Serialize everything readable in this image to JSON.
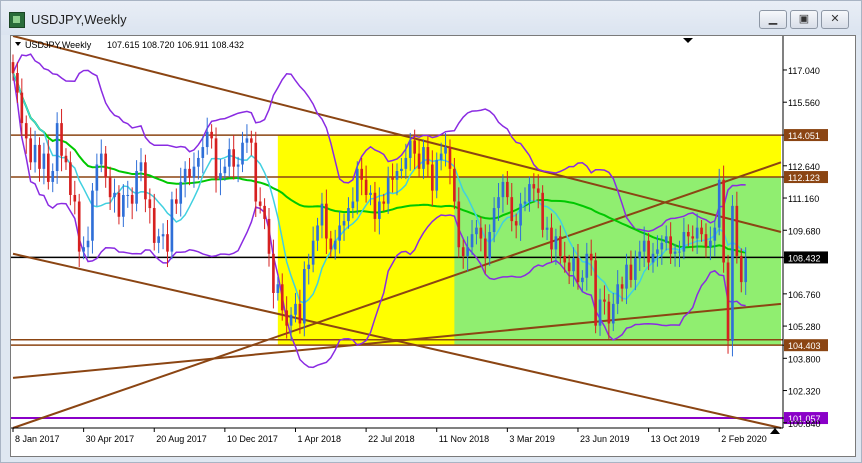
{
  "window": {
    "title": "USDJPY,Weekly",
    "minimize_label": "▁",
    "maximize_label": "▣",
    "close_label": "✕"
  },
  "chart_data": {
    "type": "candlestick",
    "symbol_label": "USDJPY,Weekly",
    "ohlc_readout": "107.615 108.720 106.911 108.432",
    "ylim": [
      100.6,
      118.6
    ],
    "y_ticks": [
      117.04,
      115.56,
      114.051,
      112.64,
      112.123,
      111.16,
      109.68,
      108.432,
      106.76,
      105.28,
      104.403,
      103.8,
      102.32,
      101.057,
      100.84
    ],
    "y_tick_labels": [
      "117.040",
      "115.560",
      "114.051",
      "112.640",
      "112.123",
      "111.160",
      "109.680",
      "108.432",
      "106.760",
      "105.280",
      "104.403",
      "103.800",
      "102.320",
      "101.057",
      "100.840"
    ],
    "x_tick_labels": [
      "8 Jan 2017",
      "30 Apr 2017",
      "20 Aug 2017",
      "10 Dec 2017",
      "1 Apr 2018",
      "22 Jul 2018",
      "11 Nov 2018",
      "3 Mar 2019",
      "23 Jun 2019",
      "13 Oct 2019",
      "2 Feb 2020"
    ],
    "x_dates_week_index": [
      0,
      16,
      32,
      48,
      64,
      80,
      96,
      112,
      128,
      144,
      160
    ],
    "highlight_labels": [
      "114.051",
      "112.123",
      "108.432",
      "104.403",
      "101.057"
    ],
    "highlight_colors": {
      "brown": "#8b4513",
      "black": "#000000",
      "purple": "#8a00c8"
    },
    "candles_close": [
      116.9,
      116.0,
      114.6,
      113.9,
      112.8,
      113.6,
      112.5,
      113.2,
      111.9,
      112.4,
      114.6,
      113.1,
      112.8,
      111.3,
      111.0,
      108.7,
      108.9,
      109.2,
      111.5,
      112.7,
      113.2,
      112.1,
      111.2,
      111.4,
      110.3,
      111.3,
      111.3,
      110.9,
      112.4,
      112.8,
      111.1,
      110.7,
      109.1,
      109.4,
      109.5,
      108.7,
      111.1,
      110.9,
      111.9,
      112.5,
      112.1,
      112.6,
      113.0,
      113.5,
      114.2,
      113.9,
      112.0,
      112.3,
      112.6,
      113.4,
      112.6,
      112.7,
      113.7,
      113.9,
      113.7,
      111.0,
      110.8,
      110.2,
      108.6,
      106.8,
      107.2,
      106.0,
      105.3,
      105.8,
      106.3,
      105.4,
      107.9,
      108.1,
      109.2,
      109.9,
      110.9,
      109.3,
      108.8,
      109.2,
      109.9,
      110.1,
      110.7,
      111.0,
      112.5,
      112.0,
      111.3,
      111.4,
      110.2,
      111.0,
      110.9,
      112.1,
      112.0,
      112.4,
      112.5,
      113.0,
      113.8,
      113.2,
      112.5,
      113.5,
      112.7,
      111.5,
      112.9,
      113.2,
      113.5,
      112.5,
      111.0,
      108.9,
      108.5,
      108.9,
      109.5,
      109.8,
      109.3,
      108.4,
      109.6,
      110.7,
      111.2,
      111.9,
      111.2,
      110.1,
      109.9,
      110.9,
      111.0,
      111.8,
      111.6,
      111.4,
      109.7,
      109.8,
      108.8,
      109.4,
      108.5,
      108.2,
      107.8,
      108.4,
      107.3,
      107.5,
      108.6,
      108.3,
      105.3,
      106.5,
      106.4,
      105.4,
      106.3,
      107.2,
      107.0,
      108.1,
      107.4,
      108.4,
      108.7,
      109.2,
      108.2,
      108.6,
      108.8,
      109.1,
      109.4,
      108.6,
      108.7,
      108.7,
      109.6,
      109.4,
      109.3,
      109.8,
      109.5,
      108.9,
      109.2,
      109.8,
      112.0,
      108.2,
      104.6,
      110.8,
      108.5,
      107.3,
      108.4
    ],
    "channel_lines": [
      {
        "name": "",
        "points": [
          [
            0,
            118.6
          ],
          [
            174,
            109.6
          ]
        ]
      },
      {
        "name": "",
        "points": [
          [
            0,
            108.6
          ],
          [
            174,
            100.6
          ]
        ]
      },
      {
        "name": "",
        "points": [
          [
            0,
            100.6
          ],
          [
            174,
            112.8
          ]
        ]
      },
      {
        "name": "",
        "points": [
          [
            0,
            102.9
          ],
          [
            174,
            106.3
          ]
        ]
      }
    ],
    "zones": [
      {
        "color": "yellow",
        "from_week": 60,
        "to_week": 174,
        "y_range": [
          104.4,
          114.05
        ]
      },
      {
        "color": "green",
        "from_week": 100,
        "to_week": 174,
        "y_range": [
          104.4,
          112.12
        ]
      }
    ],
    "grid": false
  }
}
